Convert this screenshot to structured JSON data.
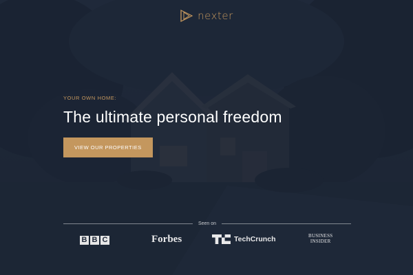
{
  "brand": {
    "name": "nexter",
    "icon": "play-chevron-icon",
    "accent_color": "#c4975e"
  },
  "hero": {
    "eyebrow": "YOUR OWN HOME:",
    "headline": "The ultimate personal freedom",
    "cta_label": "VIEW OUR PROPERTIES",
    "background_color": "#1d2636"
  },
  "press": {
    "label": "Seen on",
    "logos": {
      "bbc": [
        "B",
        "B",
        "C"
      ],
      "forbes": "Forbes",
      "techcrunch": "TechCrunch",
      "business_insider_line1": "BUSINESS",
      "business_insider_line2": "INSIDER"
    }
  }
}
